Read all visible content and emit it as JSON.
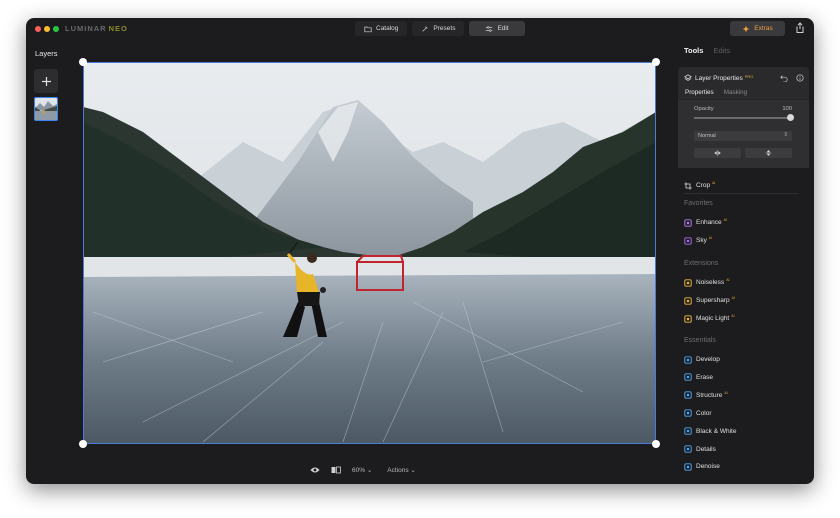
{
  "app": {
    "brand_main": "LUMINAR",
    "brand_sub": "NEO"
  },
  "topnav": {
    "catalog": "Catalog",
    "presets": "Presets",
    "edit": "Edit",
    "active": "Edit"
  },
  "extras_label": "Extras",
  "layers": {
    "title": "Layers"
  },
  "bottombar": {
    "zoom": "60%",
    "actions": "Actions"
  },
  "panel": {
    "tabs": {
      "tools": "Tools",
      "edits": "Edits",
      "active": "Tools"
    },
    "layer_properties": {
      "title": "Layer Properties",
      "badge": "PRO",
      "subtabs": {
        "properties": "Properties",
        "masking": "Masking"
      },
      "opacity_label": "Opacity",
      "opacity_value": "100",
      "opacity_fraction": 1.0,
      "blend_mode": "Normal"
    },
    "crop": {
      "label": "Crop",
      "badge": "AI"
    },
    "sections": {
      "favorites": "Favorites",
      "extensions": "Extensions",
      "essentials": "Essentials"
    },
    "favorites": [
      {
        "label": "Enhance",
        "badge": "AI",
        "icon": "enhance-icon",
        "color": "#b57cf0"
      },
      {
        "label": "Sky",
        "badge": "AI",
        "icon": "sky-icon",
        "color": "#a26ef0"
      }
    ],
    "extensions": [
      {
        "label": "Noiseless",
        "badge": "AI",
        "icon": "noiseless-icon",
        "color": "#e9b53a"
      },
      {
        "label": "Supersharp",
        "badge": "AI",
        "icon": "supersharp-icon",
        "color": "#e9b53a"
      },
      {
        "label": "Magic Light",
        "badge": "AI",
        "icon": "magic-light-icon",
        "color": "#e9b53a"
      }
    ],
    "essentials": [
      {
        "label": "Develop",
        "badge": "",
        "icon": "develop-icon",
        "color": "#4aa3f0"
      },
      {
        "label": "Erase",
        "badge": "",
        "icon": "erase-icon",
        "color": "#4aa3f0"
      },
      {
        "label": "Structure",
        "badge": "AI",
        "icon": "structure-icon",
        "color": "#4aa3f0"
      },
      {
        "label": "Color",
        "badge": "",
        "icon": "color-icon",
        "color": "#4aa3f0"
      },
      {
        "label": "Black & White",
        "badge": "",
        "icon": "black-white-icon",
        "color": "#4aa3f0"
      },
      {
        "label": "Details",
        "badge": "",
        "icon": "details-icon",
        "color": "#4aa3f0"
      },
      {
        "label": "Denoise",
        "badge": "",
        "icon": "denoise-icon",
        "color": "#4aa3f0"
      }
    ]
  },
  "colors": {
    "accent": "#3c82f0",
    "ai_badge": "#e5a83a",
    "extras_text": "#f0a040",
    "window_bg": "#1c1c1e"
  }
}
